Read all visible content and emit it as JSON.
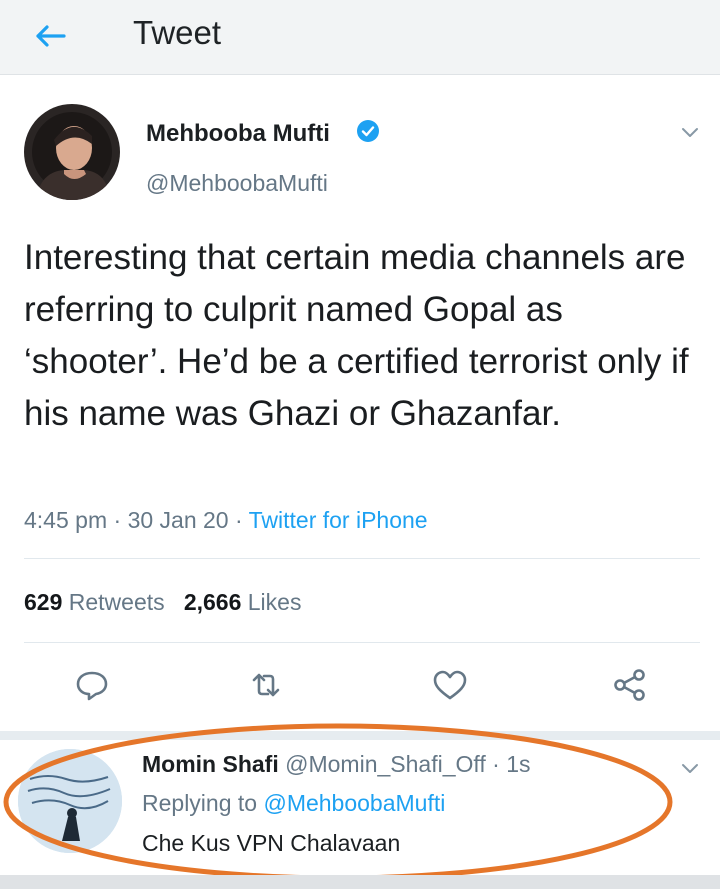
{
  "header": {
    "title": "Tweet",
    "back_icon": "arrow-left-icon"
  },
  "tweet": {
    "author_name": "Mehbooba Mufti",
    "author_handle": "@MehboobaMufti",
    "verified": true,
    "text": "Interesting that certain media channels are referring to culprit named Gopal as ‘shooter’. He’d be a certified terrorist only if his name was Ghazi or Ghazanfar.",
    "time": "4:45 pm",
    "date": "30 Jan 20",
    "source": "Twitter for iPhone",
    "retweet_count": "629",
    "retweet_label": "Retweets",
    "like_count": "2,666",
    "like_label": "Likes"
  },
  "actions": [
    "reply-icon",
    "retweet-icon",
    "like-icon",
    "share-icon"
  ],
  "reply": {
    "author_name": "Momin Shafi",
    "author_handle": "@Momin_Shafi_Off",
    "time": "1s",
    "replying_label": "Replying to",
    "replying_to": "@MehboobaMufti",
    "text": "Che Kus VPN Chalavaan"
  },
  "colors": {
    "accent": "#1da1f2",
    "secondary_text": "#657786",
    "highlight_ellipse": "#e5762a"
  }
}
